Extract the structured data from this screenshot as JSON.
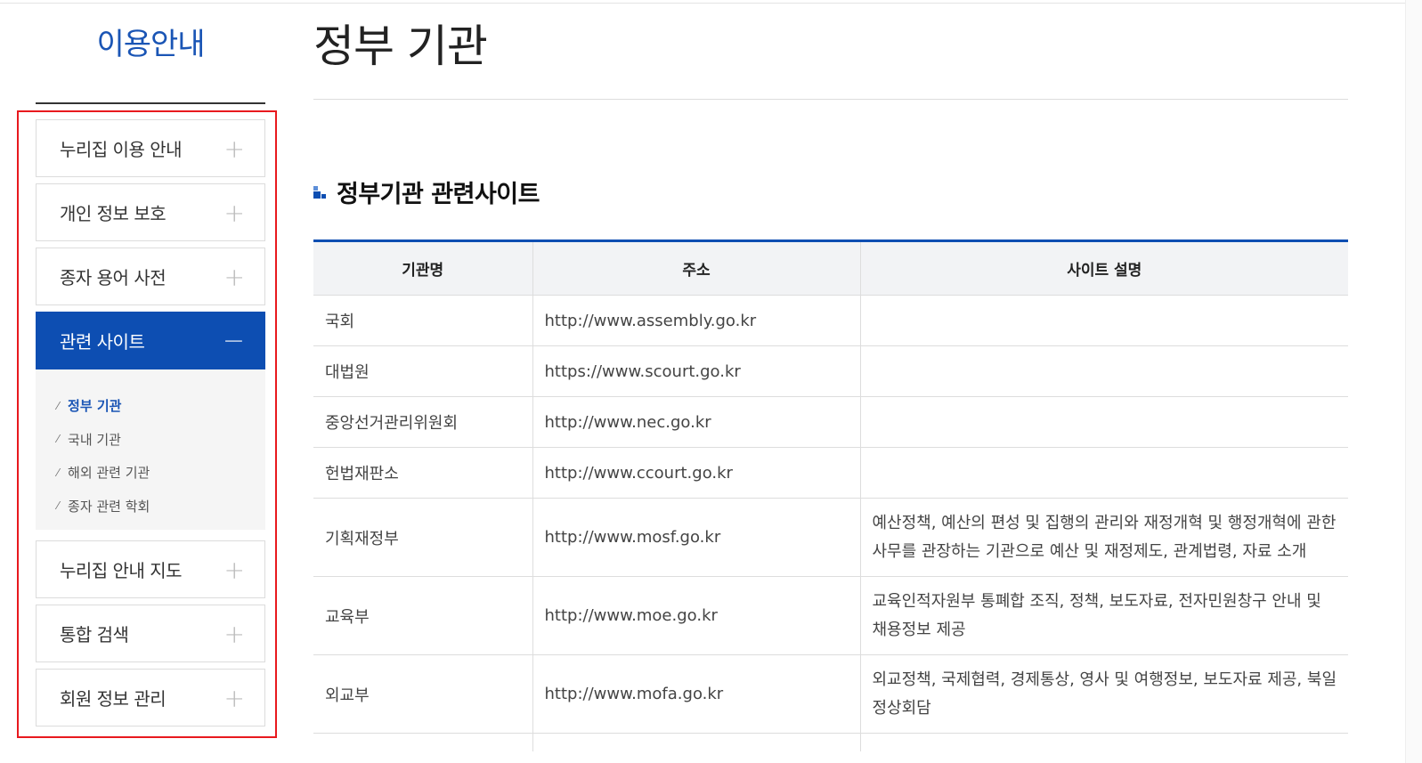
{
  "sidebar": {
    "title": "이용안내",
    "menu": [
      {
        "label": "누리집 이용 안내",
        "toggle": "+"
      },
      {
        "label": "개인 정보 보호",
        "toggle": "+"
      },
      {
        "label": "종자 용어 사전",
        "toggle": "+"
      },
      {
        "label": "관련 사이트",
        "toggle": "−",
        "active": true
      }
    ],
    "submenu": [
      {
        "label": "정부 기관",
        "current": true
      },
      {
        "label": "국내 기관"
      },
      {
        "label": "해외 관련 기관"
      },
      {
        "label": "종자 관련 학회"
      }
    ],
    "menu_after": [
      {
        "label": "누리집 안내 지도",
        "toggle": "+"
      },
      {
        "label": "통합 검색",
        "toggle": "+"
      },
      {
        "label": "회원 정보 관리",
        "toggle": "+"
      }
    ]
  },
  "main": {
    "page_title": "정부 기관",
    "section_title": "정부기관 관련사이트",
    "table": {
      "headers": [
        "기관명",
        "주소",
        "사이트 설명"
      ],
      "rows": [
        {
          "name": "국회",
          "url": "http://www.assembly.go.kr",
          "desc": ""
        },
        {
          "name": "대법원",
          "url": "https://www.scourt.go.kr",
          "desc": ""
        },
        {
          "name": "중앙선거관리위원회",
          "url": "http://www.nec.go.kr",
          "desc": ""
        },
        {
          "name": "헌법재판소",
          "url": "http://www.ccourt.go.kr",
          "desc": ""
        },
        {
          "name": "기획재정부",
          "url": "http://www.mosf.go.kr",
          "desc": "예산정책, 예산의 편성 및 집행의 관리와 재정개혁 및 행정개혁에 관한 사무를 관장하는 기관으로 예산 및 재정제도, 관계법령, 자료 소개"
        },
        {
          "name": "교육부",
          "url": "http://www.moe.go.kr",
          "desc": "교육인적자원부 통폐합 조직, 정책, 보도자료, 전자민원창구 안내 및 채용정보 제공"
        },
        {
          "name": "외교부",
          "url": "http://www.mofa.go.kr",
          "desc": "외교정책, 국제협력, 경제통상, 영사 및 여행정보, 보도자료 제공, 북일정상회담"
        }
      ]
    }
  },
  "colors": {
    "accent": "#0d4eb2",
    "highlight_border": "#e8191e",
    "title_blue": "#1a55b5"
  },
  "icons": {
    "expand": "plus-icon",
    "collapse": "minus-icon",
    "sub_bullet": "check-tick-icon",
    "section_bullet": "square-bullet-icon"
  }
}
